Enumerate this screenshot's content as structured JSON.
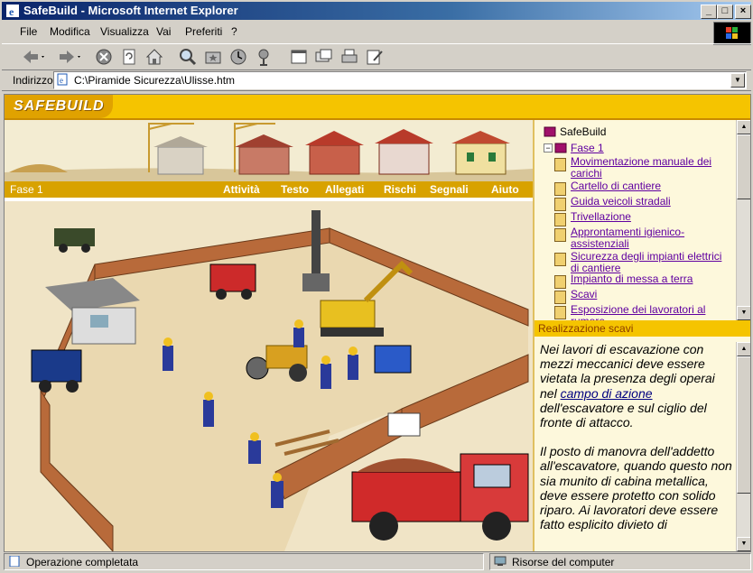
{
  "window": {
    "title": "SafeBuild - Microsoft Internet Explorer"
  },
  "menu": [
    "File",
    "Modifica",
    "Visualizza",
    "Vai",
    "Preferiti",
    "?"
  ],
  "toolbar_icons": [
    "back-icon",
    "forward-icon",
    "stop-icon",
    "refresh-icon",
    "home-icon",
    "search-icon",
    "favorites-icon",
    "history-icon",
    "channels-icon",
    "fullscreen-icon",
    "mail-icon",
    "print-icon",
    "edit-icon"
  ],
  "address": {
    "label": "Indirizzo",
    "value": "C:\\Piramide Sicurezza\\Ulisse.htm"
  },
  "page": {
    "logo": "SAFEBUILD",
    "phase": "Fase 1",
    "nav": [
      "Attività",
      "Testo",
      "Allegati",
      "Rischi",
      "Segnali",
      "Aiuto"
    ],
    "tree": {
      "root": "SafeBuild",
      "phase": "Fase 1",
      "items": [
        "Movimentazione manuale dei carichi",
        "Cartello di cantiere",
        "Guida veicoli stradali",
        "Trivellazione",
        "Approntamenti igienico-assistenziali",
        "Sicurezza degli impianti elettrici di cantiere",
        "Impianto di messa a terra",
        "Scavi",
        "Esposizione dei lavoratori al rumore"
      ]
    },
    "section_title": "Realizzazione scavi",
    "text": {
      "p1_before": "Nei lavori di escavazione con mezzi meccanici deve essere vietata la presenza degli operai nel ",
      "p1_link": "campo di azione",
      "p1_after": " dell'escavatore e sul ciglio del fronte di attacco.",
      "p2": "Il posto di manovra dell'addetto all'escavatore, quando questo non sia munito di cabina metallica, deve essere protetto con solido riparo. Ai lavoratori deve essere fatto esplicito divieto di"
    }
  },
  "status": {
    "left": "Operazione completata",
    "right": "Risorse del computer"
  },
  "colors": {
    "title_bar": "#0a246a",
    "accent_yellow": "#f5c400",
    "link_purple": "#6000a0"
  }
}
